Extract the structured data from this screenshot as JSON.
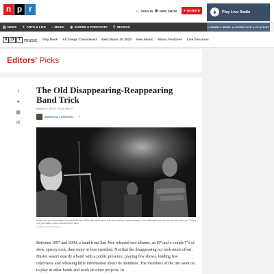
{
  "header": {
    "logo_letters": [
      "n",
      "p",
      "r"
    ],
    "sign_in": "SIGN IN",
    "shop": "NPR SHOP",
    "donate": "DONATE"
  },
  "player": {
    "title": "Play Live Radio",
    "links": [
      "HOURLY NEWS",
      "LISTEN LIVE",
      "PLAYLIST"
    ]
  },
  "nav": {
    "items": [
      {
        "label": "NEWS",
        "icon": "newspaper-icon"
      },
      {
        "label": "ARTS & LIFE",
        "icon": "arts-icon"
      },
      {
        "label": "MUSIC",
        "icon": "music-note-icon"
      },
      {
        "label": "SHOWS & PODCASTS",
        "icon": "podcast-icon"
      },
      {
        "label": "SEARCH",
        "icon": "search-icon"
      }
    ]
  },
  "music_nav": {
    "logo_letters": [
      "n",
      "p",
      "r"
    ],
    "logo_word": "music",
    "links": [
      "Tiny Desk",
      "All Songs Considered",
      "Best Music Of 2020",
      "New Music",
      "Music Features",
      "Live Sessions"
    ]
  },
  "section": {
    "title_bold": "Editors'",
    "title_light": "Picks"
  },
  "article": {
    "title": "The Old Disappearing-Reappearing Band Trick",
    "date": "March 22, 2019 · 10:30 AM ET",
    "author": "MARISSA LORUSSO",
    "share_icons": [
      "facebook-icon",
      "twitter-icon",
      "flipboard-icon",
      "email-icon"
    ],
    "caption": "Duster was one of hundreds of bands in the late 1990s who made music that was loved by a small audience, then disbanded and assumed its story was over. Then a new generation of fans discovered the band.",
    "credit": "Courtesy of Numero Group",
    "body": "Between 1997 and 2000, a band from San Jose released two albums, an EP and a couple 7\"s of slow, spacey rock, then more or less vanished. Not that the disappearing act took much effort. Duster wasn't exactly a band with a public presence, playing few shows, lending few interviews and releasing little information about its members. The members of the trio went on to play in other bands and work on other projects. In"
  },
  "colors": {
    "brand_red": "#d62021",
    "brand_blue": "#237bbd",
    "player_bg": "#3a4f66",
    "nav_bg": "#3a3a3a",
    "link_blue": "#2c5a8a"
  }
}
